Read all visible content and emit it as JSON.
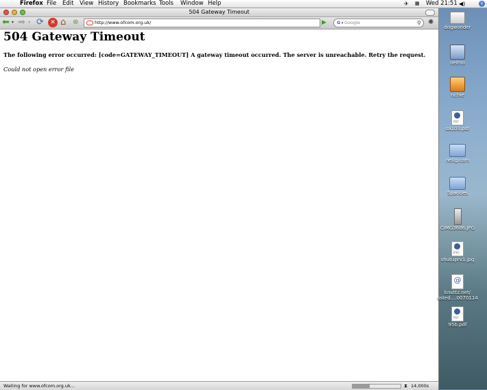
{
  "menubar": {
    "apple_icon": "apple-icon",
    "app_name": "Firefox",
    "menus": [
      "File",
      "Edit",
      "View",
      "History",
      "Bookmarks",
      "Tools",
      "Window",
      "Help"
    ],
    "clock": "Wed 21:51"
  },
  "window": {
    "title": "504 Gateway Timeout"
  },
  "toolbar": {
    "url": "http://www.ofcom.org.uk/",
    "search_placeholder": "Google"
  },
  "page": {
    "heading": "504 Gateway Timeout",
    "error_message": "The following error occurred: [code=GATEWAY_TIMEOUT] A gateway timeout occurred. The server is unreachable. Retry the request.",
    "error_file": "Could not open error file"
  },
  "statusbar": {
    "text": "Waiting for www.ofcom.org.uk...",
    "timing": "14,000s",
    "progress": 0.35
  },
  "desktop": {
    "icons": [
      {
        "label": "dogwonder",
        "type": "drive"
      },
      {
        "label": "nelmo",
        "type": "idisk"
      },
      {
        "label": "richie",
        "type": "home"
      },
      {
        "label": "sa103.pdf",
        "type": "pdf"
      },
      {
        "label": "nellg.com",
        "type": "folder"
      },
      {
        "label": "Sparkles",
        "type": "folder"
      },
      {
        "label": "CIMG3686.JPG",
        "type": "image"
      },
      {
        "label": "shutuprv1.jpg",
        "type": "jpeg"
      },
      {
        "label": "knuttz.net/",
        "label2": "osted....0070114",
        "type": "webloc"
      },
      {
        "label": "95b.pdf",
        "type": "pdf"
      }
    ]
  }
}
